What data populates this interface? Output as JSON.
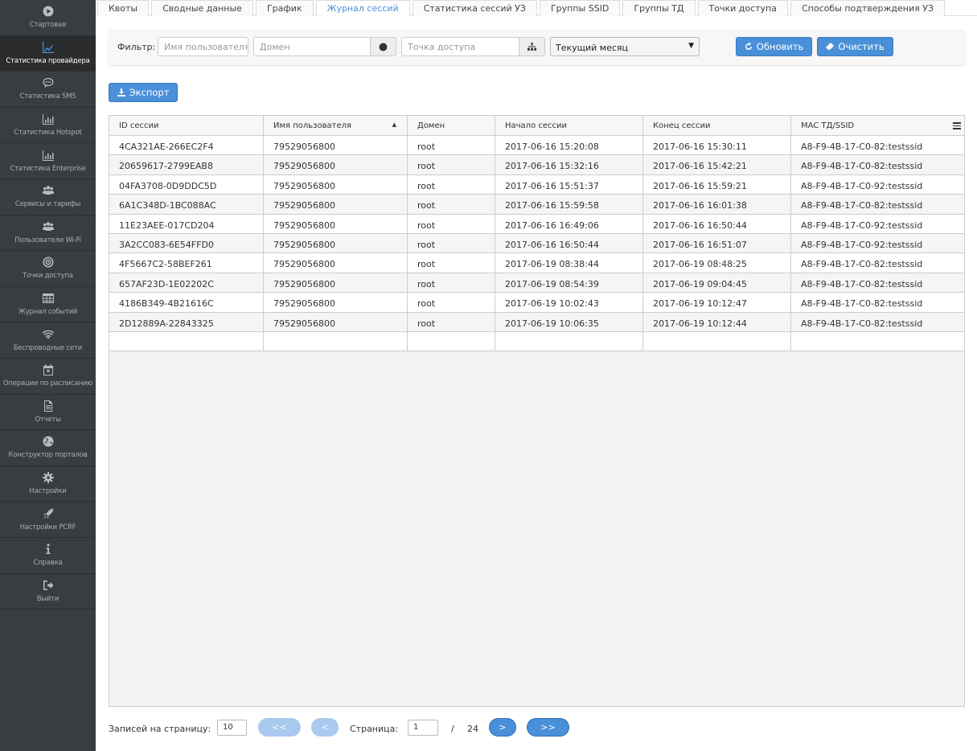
{
  "sidebar": {
    "items": [
      {
        "label": "Стартовая",
        "icon": "play-circle-icon"
      },
      {
        "label": "Статистика провайдера",
        "icon": "line-chart-icon",
        "active": true
      },
      {
        "label": "Статистика SMS",
        "icon": "chat-bubble-icon"
      },
      {
        "label": "Статистика Hotspot",
        "icon": "bar-chart-icon"
      },
      {
        "label": "Статистика Enterprise",
        "icon": "bar-chart-icon"
      },
      {
        "label": "Сервисы и тарифы",
        "icon": "users-icon"
      },
      {
        "label": "Пользователи Wi-Fi",
        "icon": "users-icon"
      },
      {
        "label": "Точки доступа",
        "icon": "target-icon"
      },
      {
        "label": "Журнал событий",
        "icon": "table-icon"
      },
      {
        "label": "Беспроводные сети",
        "icon": "wifi-icon"
      },
      {
        "label": "Операции по расписанию",
        "icon": "calendar-x-icon"
      },
      {
        "label": "Отчеты",
        "icon": "document-icon"
      },
      {
        "label": "Конструктор порталов",
        "icon": "globe-icon"
      },
      {
        "label": "Настройки",
        "icon": "gear-icon"
      },
      {
        "label": "Настройки PCRF",
        "icon": "rocket-icon"
      },
      {
        "label": "Справка",
        "icon": "info-icon"
      },
      {
        "label": "Выйти",
        "icon": "sign-out-icon"
      }
    ]
  },
  "tabs": [
    {
      "label": "Квоты"
    },
    {
      "label": "Сводные данные"
    },
    {
      "label": "График"
    },
    {
      "label": "Журнал сессий",
      "active": true
    },
    {
      "label": "Статистика сессий УЗ"
    },
    {
      "label": "Группы SSID"
    },
    {
      "label": "Группы ТД"
    },
    {
      "label": "Точки доступа"
    },
    {
      "label": "Способы подтверждения УЗ"
    }
  ],
  "filter": {
    "label": "Фильтр:",
    "user_placeholder": "Имя пользователя",
    "domain_placeholder": "Домен",
    "ap_placeholder": "Точка доступа",
    "period": "Текущий месяц",
    "refresh": "Обновить",
    "clear": "Очистить"
  },
  "export_label": "Экспорт",
  "table": {
    "columns": [
      "ID сессии",
      "Имя пользователя",
      "Домен",
      "Начало сессии",
      "Конец сессии",
      "MAC ТД/SSID"
    ],
    "sorted_column": "Имя пользователя",
    "rows": [
      [
        "4CA321AE-266EC2F4",
        "79529056800",
        "root",
        "2017-06-16 15:20:08",
        "2017-06-16 15:30:11",
        "A8-F9-4B-17-C0-82:testssid"
      ],
      [
        "20659617-2799EAB8",
        "79529056800",
        "root",
        "2017-06-16 15:32:16",
        "2017-06-16 15:42:21",
        "A8-F9-4B-17-C0-82:testssid"
      ],
      [
        "04FA3708-0D9DDC5D",
        "79529056800",
        "root",
        "2017-06-16 15:51:37",
        "2017-06-16 15:59:21",
        "A8-F9-4B-17-C0-92:testssid"
      ],
      [
        "6A1C348D-1BC088AC",
        "79529056800",
        "root",
        "2017-06-16 15:59:58",
        "2017-06-16 16:01:38",
        "A8-F9-4B-17-C0-82:testssid"
      ],
      [
        "11E23AEE-017CD204",
        "79529056800",
        "root",
        "2017-06-16 16:49:06",
        "2017-06-16 16:50:44",
        "A8-F9-4B-17-C0-92:testssid"
      ],
      [
        "3A2CC083-6E54FFD0",
        "79529056800",
        "root",
        "2017-06-16 16:50:44",
        "2017-06-16 16:51:07",
        "A8-F9-4B-17-C0-92:testssid"
      ],
      [
        "4F5667C2-58BEF261",
        "79529056800",
        "root",
        "2017-06-19 08:38:44",
        "2017-06-19 08:48:25",
        "A8-F9-4B-17-C0-82:testssid"
      ],
      [
        "657AF23D-1E02202C",
        "79529056800",
        "root",
        "2017-06-19 08:54:39",
        "2017-06-19 09:04:45",
        "A8-F9-4B-17-C0-82:testssid"
      ],
      [
        "4186B349-4B21616C",
        "79529056800",
        "root",
        "2017-06-19 10:02:43",
        "2017-06-19 10:12:47",
        "A8-F9-4B-17-C0-82:testssid"
      ],
      [
        "2D12889A-22843325",
        "79529056800",
        "root",
        "2017-06-19 10:06:35",
        "2017-06-19 10:12:44",
        "A8-F9-4B-17-C0-82:testssid"
      ]
    ]
  },
  "pager": {
    "per_page_label": "Записей на страницу:",
    "per_page": "10",
    "first": "<<",
    "prev": "<",
    "page_label": "Страница:",
    "page": "1",
    "sep": "/",
    "total_pages": "24",
    "next": ">",
    "last": ">>"
  },
  "colors": {
    "accent": "#4a90d9",
    "sidebar": "#3a3d40"
  }
}
